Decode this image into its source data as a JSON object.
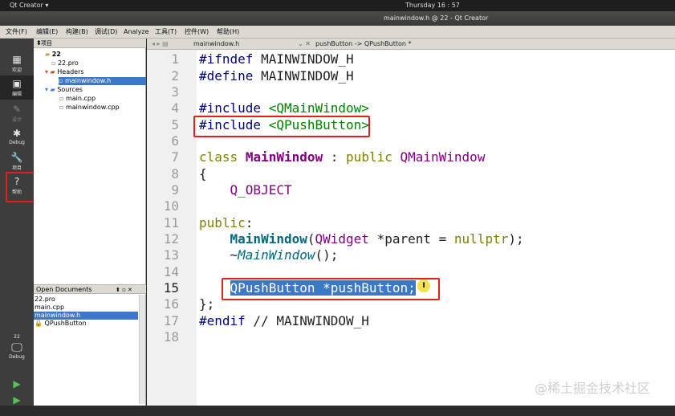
{
  "topbar": {
    "app": "Qt Creator ▾",
    "clock": "Thursday 16 : 57"
  },
  "window": {
    "title": "mainwindow.h @ 22 - Qt Creator"
  },
  "menus": [
    "文件(F)",
    "编辑(E)",
    "构建(B)",
    "调试(D)",
    "Analyze",
    "工具(T)",
    "控件(W)",
    "帮助(H)"
  ],
  "modes": [
    {
      "label": "欢迎",
      "icon": "▦"
    },
    {
      "label": "编辑",
      "icon": "▣"
    },
    {
      "label": "设计",
      "icon": "✎"
    },
    {
      "label": "Debug",
      "icon": "✱"
    },
    {
      "label": "项目",
      "icon": "🔧"
    },
    {
      "label": "帮助",
      "icon": "?"
    }
  ],
  "kit": {
    "project": "22",
    "mode": "Debug"
  },
  "project_panel": {
    "title": "项目",
    "tree": [
      {
        "label": "22"
      },
      {
        "label": "22.pro"
      },
      {
        "label": "Headers"
      },
      {
        "label": "mainwindow.h"
      },
      {
        "label": "Sources"
      },
      {
        "label": "main.cpp"
      },
      {
        "label": "mainwindow.cpp"
      }
    ]
  },
  "open_documents": {
    "title": "Open Documents",
    "items": [
      "22.pro",
      "main.cpp",
      "mainwindow.h",
      "QPushButton"
    ]
  },
  "editor": {
    "tab": "mainwindow.h",
    "symbol": "pushButton -> QPushButton *",
    "current_line": "15",
    "lines": [
      {
        "n": "1",
        "t": "#ifndef MAINWINDOW_H"
      },
      {
        "n": "2",
        "t": "#define MAINWINDOW_H"
      },
      {
        "n": "3",
        "t": ""
      },
      {
        "n": "4",
        "t": "#include <QMainWindow>"
      },
      {
        "n": "5",
        "t": "#include <QPushButton>"
      },
      {
        "n": "6",
        "t": ""
      },
      {
        "n": "7",
        "t": "class MainWindow : public QMainWindow"
      },
      {
        "n": "8",
        "t": "{"
      },
      {
        "n": "9",
        "t": "    Q_OBJECT"
      },
      {
        "n": "10",
        "t": ""
      },
      {
        "n": "11",
        "t": "public:"
      },
      {
        "n": "12",
        "t": "    MainWindow(QWidget *parent = nullptr);"
      },
      {
        "n": "13",
        "t": "    ~MainWindow();"
      },
      {
        "n": "14",
        "t": ""
      },
      {
        "n": "15",
        "t": "    QPushButton *pushButton;"
      },
      {
        "n": "16",
        "t": "};"
      },
      {
        "n": "17",
        "t": "#endif // MAINWINDOW_H"
      },
      {
        "n": "18",
        "t": ""
      }
    ]
  },
  "watermark": "@稀土掘金技术社区",
  "colors": {
    "highlight": "#e0201a",
    "selection": "#3d78c7"
  }
}
